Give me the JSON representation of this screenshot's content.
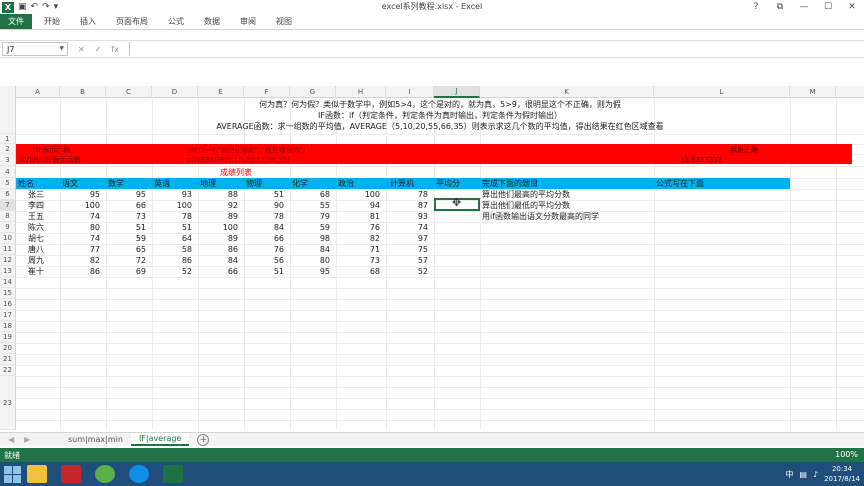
{
  "window": {
    "title": "excel系列教程.xlsx - Excel",
    "controls": [
      "?",
      "⧉",
      "—",
      "☐",
      "✕"
    ]
  },
  "ribbon": {
    "file_label": "文件",
    "tabs": [
      "开始",
      "插入",
      "页面布局",
      "公式",
      "数据",
      "审阅",
      "视图"
    ]
  },
  "formula_bar": {
    "name_box": "J7",
    "cancel_glyph": "✕",
    "enter_glyph": "✓",
    "fx_label": "fx",
    "formula": ""
  },
  "columns": [
    "A",
    "B",
    "C",
    "D",
    "E",
    "F",
    "G",
    "H",
    "I",
    "J",
    "K",
    "L",
    "M"
  ],
  "selected_column": "J",
  "rows": [
    "1",
    "2",
    "3",
    "4",
    "5",
    "6",
    "7",
    "8",
    "9",
    "10",
    "11",
    "12",
    "13",
    "14",
    "15",
    "16",
    "17",
    "18",
    "19",
    "20",
    "21",
    "22",
    "23"
  ],
  "selected_row": "7",
  "notes": {
    "line1": "何为真？何为假？类似于数学中，例如5>4，这个是对的，就为真，5>9，很明显这个不正确，则为假",
    "line2": "IF函数：if（判定条件，判定条件为真时输出，判定条件为假时输出）",
    "line3": "AVERAGE函数：求一组数的平均值，AVERAGE（5,10,20,55,66,35）则表示求这几个数的平均值，得出结果在红色区域查看"
  },
  "red_band": {
    "row2_a": "IF表示示例",
    "row2_mid": "=IF(5>4,\"我是正确的\",\"我是错误的\")",
    "row2_right": "我是正确",
    "row3_a": "AVERAGE表示示例",
    "row3_mid": "=AVERAGE(5,10,20,55,66,35)",
    "row3_right": "31.8333333"
  },
  "table_title": "成绩列表",
  "table": {
    "headers": [
      "姓名",
      "语文",
      "数学",
      "英语",
      "地理",
      "物理",
      "化学",
      "政治",
      "计算机",
      "平均分"
    ],
    "rows": [
      [
        "张三",
        "95",
        "95",
        "93",
        "88",
        "51",
        "68",
        "100",
        "78"
      ],
      [
        "李四",
        "100",
        "66",
        "100",
        "92",
        "90",
        "55",
        "94",
        "87"
      ],
      [
        "王五",
        "74",
        "73",
        "78",
        "89",
        "78",
        "79",
        "81",
        "93"
      ],
      [
        "陈六",
        "80",
        "51",
        "51",
        "100",
        "84",
        "59",
        "76",
        "74"
      ],
      [
        "胡七",
        "74",
        "59",
        "64",
        "89",
        "66",
        "98",
        "82",
        "97"
      ],
      [
        "唐八",
        "77",
        "65",
        "58",
        "86",
        "76",
        "84",
        "71",
        "75"
      ],
      [
        "周九",
        "82",
        "72",
        "86",
        "84",
        "56",
        "80",
        "73",
        "57"
      ],
      [
        "崔十",
        "86",
        "69",
        "52",
        "66",
        "51",
        "95",
        "68",
        "52"
      ]
    ]
  },
  "tasks": {
    "header": "完成下面的题目",
    "formula_hint": "公式写在下面",
    "items": [
      "算出他们最高的平均分数",
      "算出他们最低的平均分数",
      "用if函数输出语文分数最高的同学"
    ]
  },
  "sheets": {
    "tabs": [
      "sum|max|min",
      "IF|average"
    ],
    "active": "IF|average",
    "add_glyph": "+"
  },
  "status": {
    "ready": "就绪",
    "zoom": "100%"
  },
  "taskbar": {
    "time": "20:34",
    "date": "2017/8/14",
    "tray_text": "中"
  },
  "colors": {
    "excel_green": "#217346",
    "red_band": "#ff0000",
    "header_band": "#00b0f0",
    "taskbar": "#1f4e7a"
  }
}
